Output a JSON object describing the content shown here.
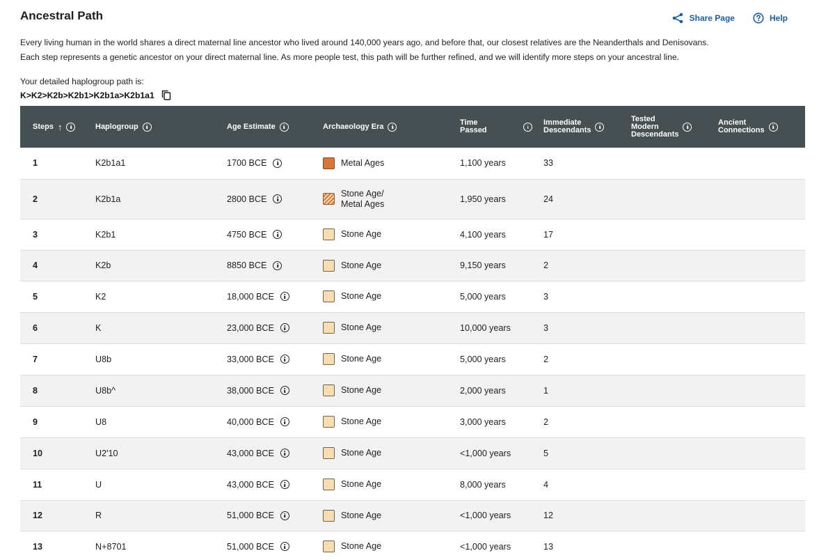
{
  "header": {
    "title": "Ancestral Path",
    "share_label": "Share Page",
    "help_label": "Help"
  },
  "description": {
    "line1": "Every living human in the world shares a direct maternal line ancestor who lived around 140,000 years ago, and before that, our closest relatives are the Neanderthals and Denisovans.",
    "line2": "Each step represents a genetic ancestor on your direct maternal line. As more people test, this path will be further refined, and we will identify more steps on your ancestral line."
  },
  "haplogroup_path": {
    "label": "Your detailed haplogroup path is:",
    "value": "K>K2>K2b>K2b1>K2b1a>K2b1a1"
  },
  "colors": {
    "header_bg": "#465052",
    "link": "#1b5fa8",
    "metal_ages": "#d9763a",
    "stone_age": "#f7ddb0"
  },
  "table": {
    "columns": {
      "steps": "Steps",
      "haplogroup": "Haplogroup",
      "age": "Age Estimate",
      "era": "Archaeology Era",
      "time_l1": "Time",
      "time_l2": "Passed",
      "imm_l1": "Immediate",
      "imm_l2": "Descendants",
      "tested_l1": "Tested",
      "tested_l2": "Modern",
      "tested_l3": "Descendants",
      "ancient_l1": "Ancient",
      "ancient_l2": "Connections"
    },
    "sort_indicator": "↑",
    "rows": [
      {
        "step": "1",
        "haplogroup": "K2b1a1",
        "age": "1700 BCE",
        "era_l1": "Metal Ages",
        "era_l2": "",
        "era_type": "metal",
        "time": "1,100 years",
        "immediate": "33"
      },
      {
        "step": "2",
        "haplogroup": "K2b1a",
        "age": "2800 BCE",
        "era_l1": "Stone Age/",
        "era_l2": "Metal Ages",
        "era_type": "mixed",
        "time": "1,950 years",
        "immediate": "24"
      },
      {
        "step": "3",
        "haplogroup": "K2b1",
        "age": "4750 BCE",
        "era_l1": "Stone Age",
        "era_l2": "",
        "era_type": "stone",
        "time": "4,100 years",
        "immediate": "17"
      },
      {
        "step": "4",
        "haplogroup": "K2b",
        "age": "8850 BCE",
        "era_l1": "Stone Age",
        "era_l2": "",
        "era_type": "stone",
        "time": "9,150 years",
        "immediate": "2"
      },
      {
        "step": "5",
        "haplogroup": "K2",
        "age": "18,000 BCE",
        "era_l1": "Stone Age",
        "era_l2": "",
        "era_type": "stone",
        "time": "5,000 years",
        "immediate": "3"
      },
      {
        "step": "6",
        "haplogroup": "K",
        "age": "23,000 BCE",
        "era_l1": "Stone Age",
        "era_l2": "",
        "era_type": "stone",
        "time": "10,000 years",
        "immediate": "3"
      },
      {
        "step": "7",
        "haplogroup": "U8b",
        "age": "33,000 BCE",
        "era_l1": "Stone Age",
        "era_l2": "",
        "era_type": "stone",
        "time": "5,000 years",
        "immediate": "2"
      },
      {
        "step": "8",
        "haplogroup": "U8b^",
        "age": "38,000 BCE",
        "era_l1": "Stone Age",
        "era_l2": "",
        "era_type": "stone",
        "time": "2,000 years",
        "immediate": "1"
      },
      {
        "step": "9",
        "haplogroup": "U8",
        "age": "40,000 BCE",
        "era_l1": "Stone Age",
        "era_l2": "",
        "era_type": "stone",
        "time": "3,000 years",
        "immediate": "2"
      },
      {
        "step": "10",
        "haplogroup": "U2'10",
        "age": "43,000 BCE",
        "era_l1": "Stone Age",
        "era_l2": "",
        "era_type": "stone",
        "time": "<1,000 years",
        "immediate": "5"
      },
      {
        "step": "11",
        "haplogroup": "U",
        "age": "43,000 BCE",
        "era_l1": "Stone Age",
        "era_l2": "",
        "era_type": "stone",
        "time": "8,000 years",
        "immediate": "4"
      },
      {
        "step": "12",
        "haplogroup": "R",
        "age": "51,000 BCE",
        "era_l1": "Stone Age",
        "era_l2": "",
        "era_type": "stone",
        "time": "<1,000 years",
        "immediate": "12"
      },
      {
        "step": "13",
        "haplogroup": "N+8701",
        "age": "51,000 BCE",
        "era_l1": "Stone Age",
        "era_l2": "",
        "era_type": "stone",
        "time": "<1,000 years",
        "immediate": "13"
      }
    ]
  }
}
